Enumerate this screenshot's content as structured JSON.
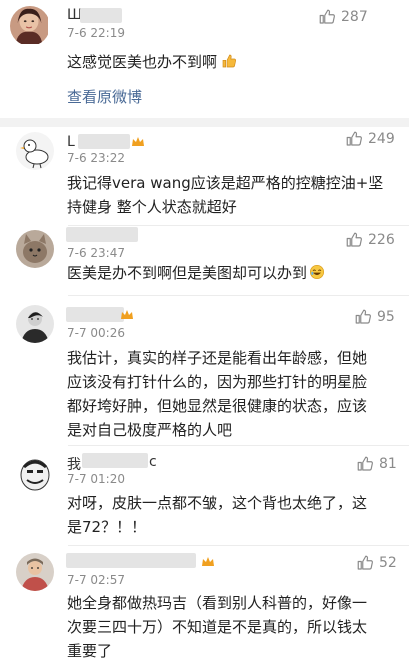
{
  "featured": {
    "name": "Ш",
    "time": "7-6 22:19",
    "likes": "287",
    "text": "这感觉医美也办不到啊",
    "thumbs_emoji": "thumbs-up-emoji",
    "view_original": "查看原微博"
  },
  "comments": [
    {
      "name": "L",
      "time": "7-6 23:22",
      "likes": "249",
      "lines": [
        "我记得vera wang应该是超严格的控糖控油+坚",
        "持健身 整个人状态就超好"
      ]
    },
    {
      "name": "",
      "time": "7-6 23:47",
      "likes": "226",
      "lines": [
        "医美是办不到啊但是美图却可以办到"
      ],
      "emoji": "laughing-emoji"
    },
    {
      "name": "",
      "time": "7-7 00:26",
      "likes": "95",
      "lines": [
        "我估计，真实的样子还是能看出年龄感，但她",
        "应该没有打针什么的，因为那些打针的明星脸",
        "都好垮好肿，但她显然是很健康的状态，应该",
        "是对自己极度严格的人吧"
      ]
    },
    {
      "name": "我",
      "name_suffix": "c",
      "time": "7-7 01:20",
      "likes": "81",
      "lines": [
        "对呀，皮肤一点都不皱，这个背也太绝了，这",
        "是72？！！"
      ]
    },
    {
      "name": "",
      "time": "7-7 02:57",
      "likes": "52",
      "lines": [
        "她全身都做热玛吉（看到别人科普的，好像一",
        "次要三四十万）不知道是不是真的，所以钱太",
        "重要了"
      ]
    }
  ],
  "colors": {
    "link": "#4a6a96",
    "meta": "#8a8a8a",
    "badge": "#f0a020",
    "divider": "#f2f2f2"
  }
}
